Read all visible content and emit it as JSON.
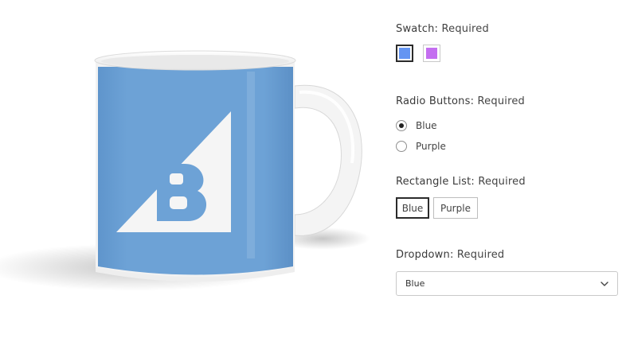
{
  "product": {
    "image_alt": "Blue coffee mug with white B logo",
    "mug_color": "#6da2d6"
  },
  "options": {
    "swatch": {
      "label": "Swatch:",
      "required": "Required",
      "items": [
        {
          "name": "Blue",
          "color": "#6495f2",
          "selected": true
        },
        {
          "name": "Purple",
          "color": "#c46ef0",
          "selected": false
        }
      ]
    },
    "radio": {
      "label": "Radio Buttons:",
      "required": "Required",
      "items": [
        {
          "label": "Blue",
          "checked": true
        },
        {
          "label": "Purple",
          "checked": false
        }
      ]
    },
    "rectangle": {
      "label": "Rectangle List:",
      "required": "Required",
      "items": [
        {
          "label": "Blue",
          "selected": true
        },
        {
          "label": "Purple",
          "selected": false
        }
      ]
    },
    "dropdown": {
      "label": "Dropdown:",
      "required": "Required",
      "value": "Blue"
    }
  }
}
